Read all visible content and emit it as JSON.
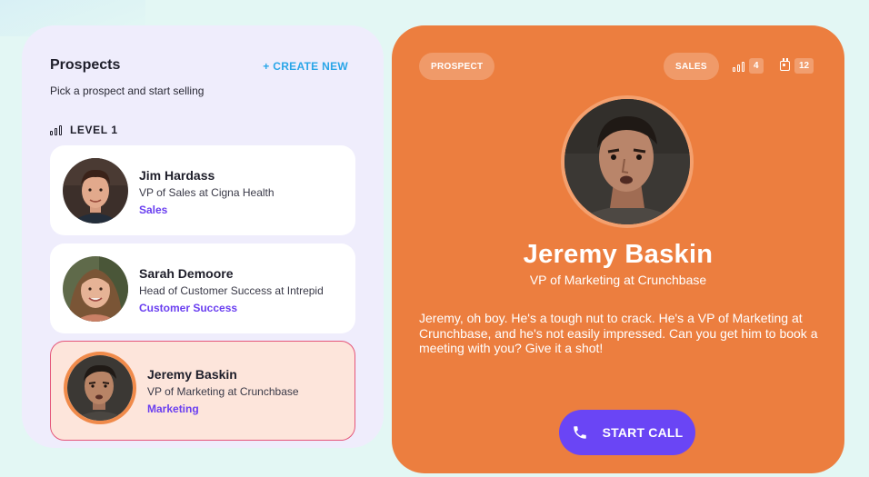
{
  "prospects_panel": {
    "title": "Prospects",
    "create_label": "+ CREATE NEW",
    "subtitle": "Pick a prospect and start selling",
    "level_label": "LEVEL 1",
    "cards": [
      {
        "name": "Jim Hardass",
        "role": "VP of Sales at Cigna Health",
        "tag": "Sales",
        "selected": false
      },
      {
        "name": "Sarah Demoore",
        "role": "Head of Customer Success at Intrepid",
        "tag": "Customer Success",
        "selected": false
      },
      {
        "name": "Jeremy Baskin",
        "role": "VP of Marketing at Crunchbase",
        "tag": "Marketing",
        "selected": true
      }
    ]
  },
  "detail": {
    "badge_prospect": "PROSPECT",
    "badge_sales": "SALES",
    "level_count": "4",
    "calendar_count": "12",
    "name": "Jeremy Baskin",
    "role": "VP of Marketing at Crunchbase",
    "description": "Jeremy, oh boy. He's a tough nut to crack. He's a VP of Marketing at Crunchbase, and he's not easily impressed. Can you get him to book a meeting with you? Give it a shot!",
    "call_label": "START CALL"
  },
  "colors": {
    "detail_bg": "#ec7e3f",
    "accent_purple": "#6a45f5",
    "link_blue": "#2aa6e8",
    "tag_purple": "#6a3ff0",
    "selected_card_bg": "#fde5db",
    "selected_card_border": "#e4557a"
  },
  "icons": [
    "signal-bars-icon",
    "calendar-icon",
    "phone-icon"
  ]
}
